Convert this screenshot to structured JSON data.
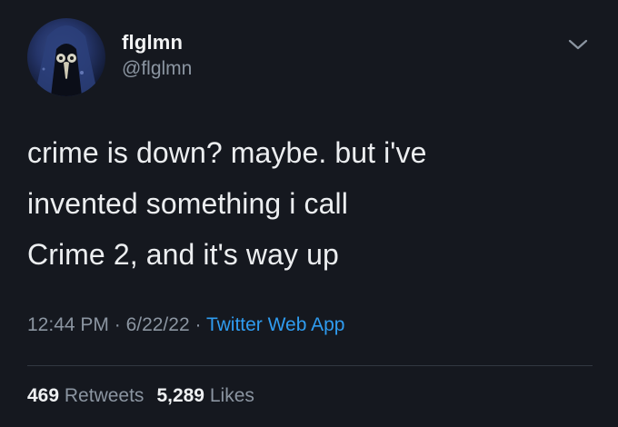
{
  "author": {
    "display_name": "flglmn",
    "handle": "@flglmn",
    "avatar_icon": "plague-doctor-avatar"
  },
  "menu_icon": "chevron-down-icon",
  "tweet": {
    "lines": [
      "crime is down? maybe. but i've",
      "invented something i call",
      "Crime 2, and it's way up"
    ]
  },
  "meta": {
    "time": "12:44 PM",
    "separator1": " · ",
    "date": "6/22/22",
    "separator2": " · ",
    "source": "Twitter Web App"
  },
  "stats": {
    "retweets_count": "469",
    "retweets_label": "Retweets",
    "likes_count": "5,289",
    "likes_label": "Likes"
  },
  "colors": {
    "background": "#15181f",
    "text": "#e7e9ea",
    "muted": "#8b95a1",
    "link": "#2f9cf0"
  }
}
